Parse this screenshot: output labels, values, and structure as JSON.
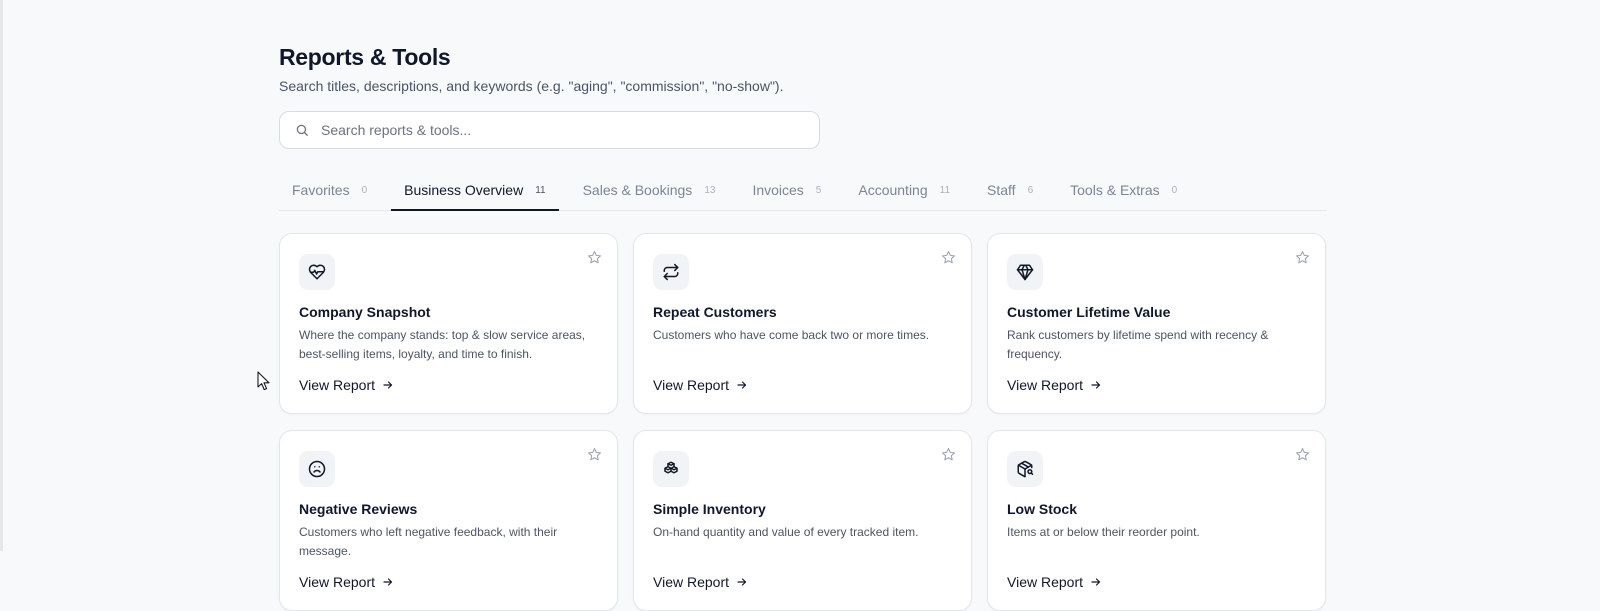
{
  "header": {
    "title": "Reports & Tools",
    "subtitle": "Search titles, descriptions, and keywords (e.g. \"aging\", \"commission\", \"no-show\")."
  },
  "search": {
    "placeholder": "Search reports & tools...",
    "value": "",
    "icon": "search-icon"
  },
  "tabs": [
    {
      "label": "Favorites",
      "count": "0",
      "active": false
    },
    {
      "label": "Business Overview",
      "count": "11",
      "active": true
    },
    {
      "label": "Sales & Bookings",
      "count": "13",
      "active": false
    },
    {
      "label": "Invoices",
      "count": "5",
      "active": false
    },
    {
      "label": "Accounting",
      "count": "11",
      "active": false
    },
    {
      "label": "Staff",
      "count": "6",
      "active": false
    },
    {
      "label": "Tools & Extras",
      "count": "0",
      "active": false
    }
  ],
  "cards": [
    {
      "icon": "heart-pulse-icon",
      "title": "Company Snapshot",
      "description": "Where the company stands: top & slow service areas, best-selling items, loyalty, and time to finish.",
      "link": "View Report"
    },
    {
      "icon": "repeat-icon",
      "title": "Repeat Customers",
      "description": "Customers who have come back two or more times.",
      "link": "View Report"
    },
    {
      "icon": "gem-icon",
      "title": "Customer Lifetime Value",
      "description": "Rank customers by lifetime spend with recency & frequency.",
      "link": "View Report"
    },
    {
      "icon": "frown-icon",
      "title": "Negative Reviews",
      "description": "Customers who left negative feedback, with their message.",
      "link": "View Report"
    },
    {
      "icon": "boxes-icon",
      "title": "Simple Inventory",
      "description": "On-hand quantity and value of every tracked item.",
      "link": "View Report"
    },
    {
      "icon": "package-search-icon",
      "title": "Low Stock",
      "description": "Items at or below their reorder point.",
      "link": "View Report"
    }
  ],
  "colors": {
    "background": "#f8f9fb",
    "text": "#0f172a",
    "muted": "#7b8596",
    "border": "#e3e6eb",
    "active_tab_underline": "#111827"
  }
}
